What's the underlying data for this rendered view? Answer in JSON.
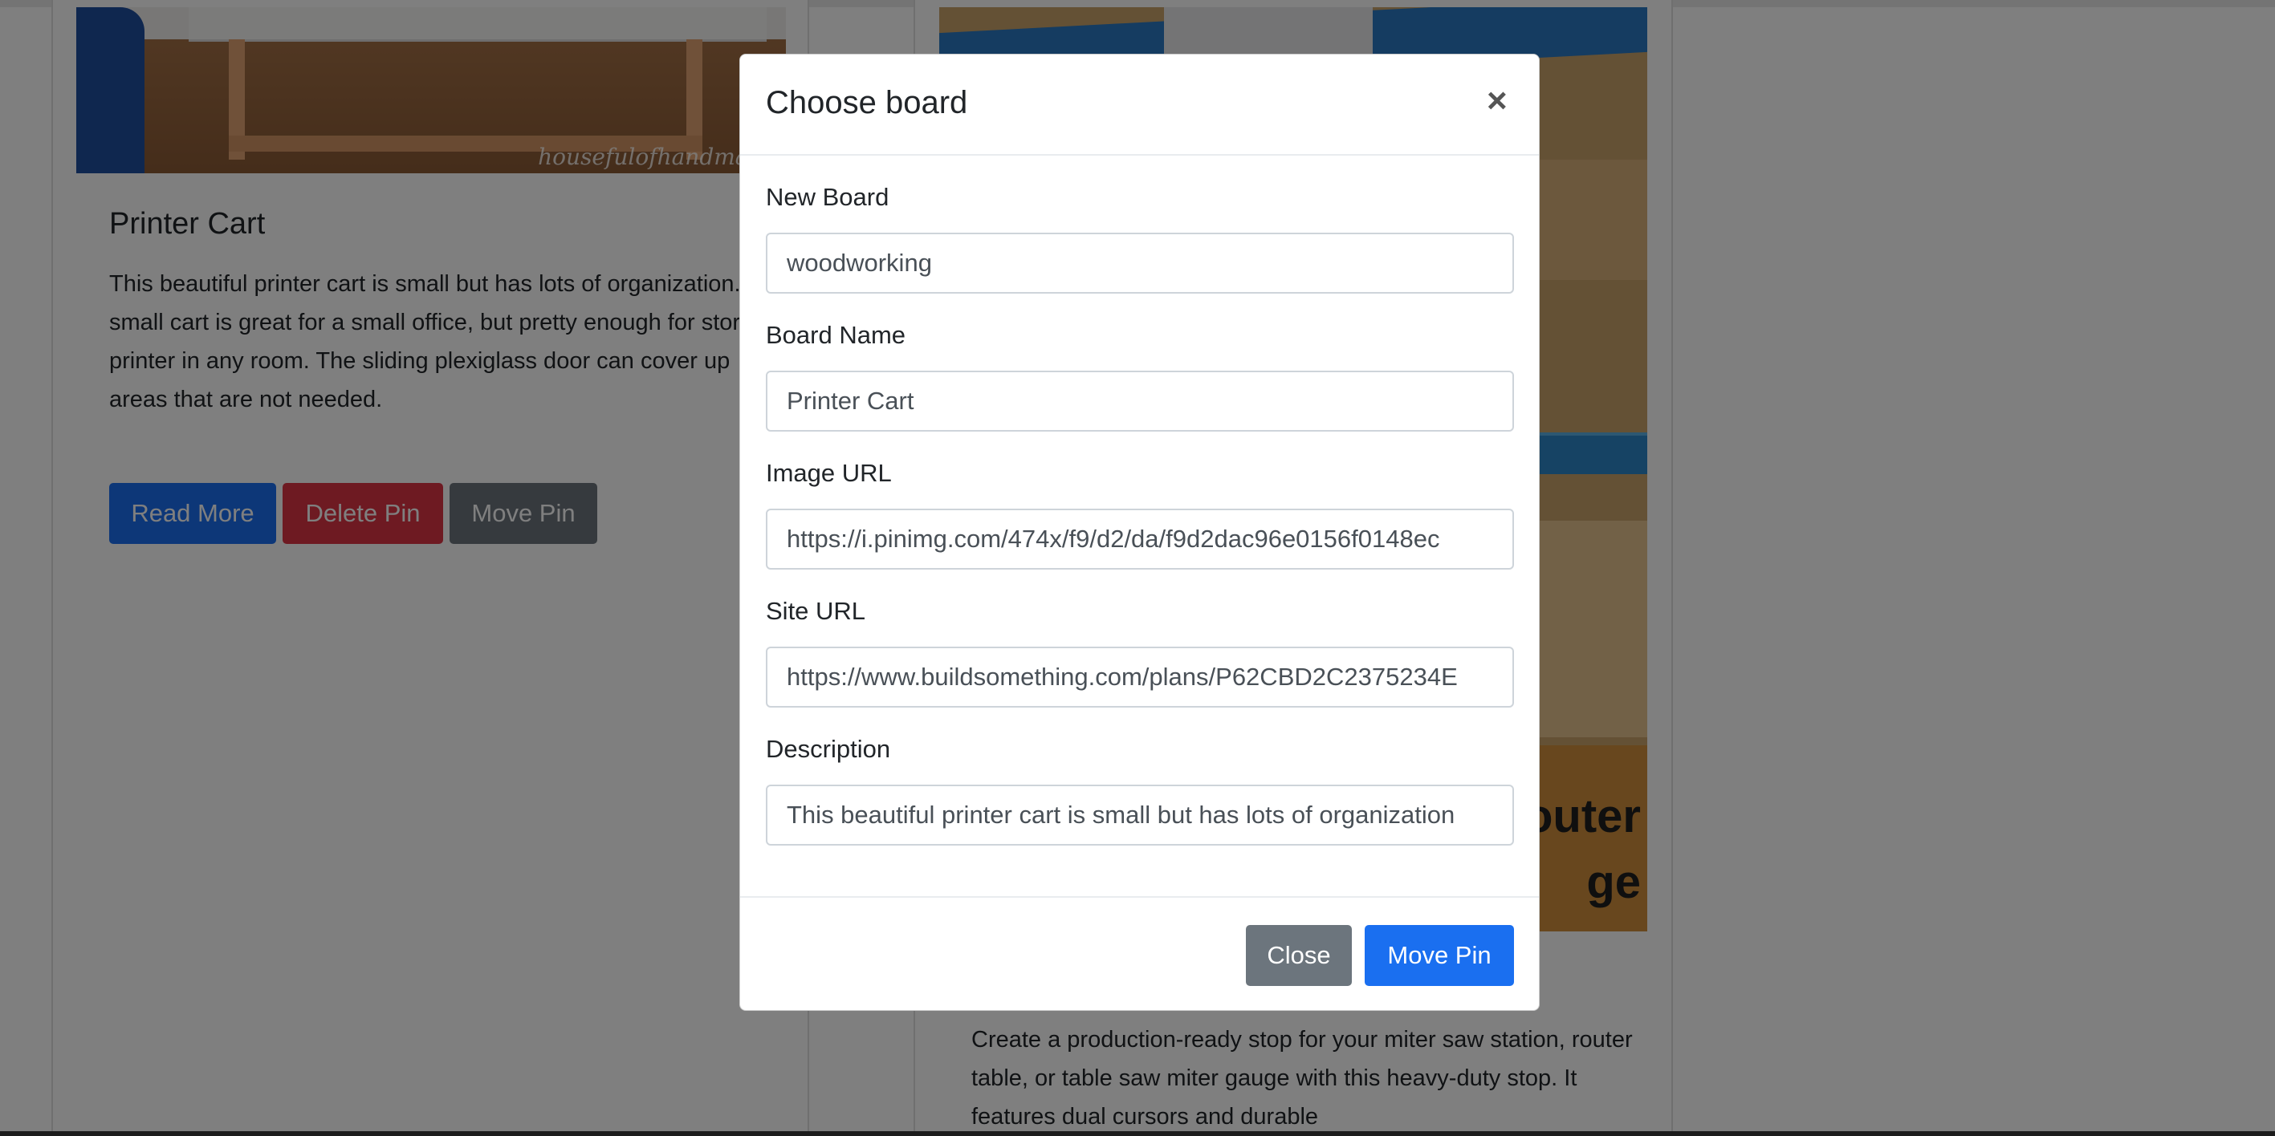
{
  "left_card": {
    "image_watermark": "housefulofhandmade",
    "title": "Printer Cart",
    "text": "This beautiful printer cart is small but has lots of organization. The small cart is great for a small office, but pretty enough for storing a printer in any room. The sliding plexiglass door can cover up areas that are not needed.",
    "buttons": {
      "read_more": "Read More",
      "delete_pin": "Delete Pin",
      "move_pin": "Move Pin"
    }
  },
  "right_card": {
    "image_text_line1": "outer",
    "image_text_line2": "ge",
    "text": "Create a production-ready stop for your miter saw station, router table, or table saw miter gauge with this heavy-duty stop. It features dual cursors and durable"
  },
  "modal": {
    "title": "Choose board",
    "close_glyph": "×",
    "fields": {
      "new_board": {
        "label": "New Board",
        "value": "woodworking"
      },
      "board_name": {
        "label": "Board Name",
        "value": "Printer Cart"
      },
      "image_url": {
        "label": "Image URL",
        "value": "https://i.pinimg.com/474x/f9/d2/da/f9d2dac96e0156f0148ec"
      },
      "site_url": {
        "label": "Site URL",
        "value": "https://www.buildsomething.com/plans/P62CBD2C2375234E"
      },
      "description": {
        "label": "Description",
        "value": "This beautiful printer cart is small but has lots of organization"
      }
    },
    "buttons": {
      "close": "Close",
      "move_pin": "Move Pin"
    }
  },
  "colors": {
    "primary": "#1a6ff0",
    "danger": "#dc3545",
    "secondary": "#6c757d",
    "backdrop": "rgba(0,0,0,0.5)"
  }
}
